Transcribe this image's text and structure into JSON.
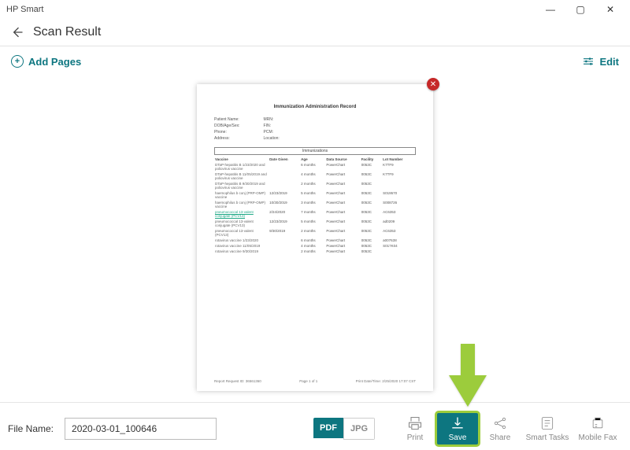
{
  "app_title": "HP Smart",
  "header": {
    "title": "Scan Result"
  },
  "toolbar": {
    "add_pages": "Add Pages",
    "edit": "Edit"
  },
  "preview": {
    "doc_title": "Immunization Administration Record",
    "left_fields": [
      "Patient Name:",
      "DOB/Age/Sex:",
      "Phone:",
      "Address:"
    ],
    "right_labels": [
      "MRN:",
      "FIN:",
      "PCM:",
      "Location:"
    ],
    "section_header": "Immunizations",
    "table": {
      "headers": [
        "Vaccine",
        "Date Given",
        "Age",
        "Data Source",
        "Facility",
        "Lot Number"
      ],
      "rows": [
        {
          "v": "DTaP-hepatitis B 1/23/2020\nand poliovirus\nvaccine",
          "d": "",
          "a": "6 months",
          "s": "PowerChart",
          "f": "0053C",
          "l": "K7TF9"
        },
        {
          "v": "DTaP-hepatitis B 11/05/2019\nand poliovirus\nvaccine",
          "d": "",
          "a": "4 months",
          "s": "PowerChart",
          "f": "0053C",
          "l": "K7TF9"
        },
        {
          "v": "DTaP-hepatitis B 9/30/2019\nand poliovirus\nvaccine",
          "d": "",
          "a": "2 months",
          "s": "PowerChart",
          "f": "0053C",
          "l": ""
        },
        {
          "v": "haemophilus b\nconj (PRP-OMP)\nvaccine",
          "d": "12/23/2019",
          "a": "5 months",
          "s": "PowerChart",
          "f": "0053C",
          "l": "S019570"
        },
        {
          "v": "haemophilus b\nconj (PRP-OMP)\nvaccine",
          "d": "10/30/2019",
          "a": "3 months",
          "s": "PowerChart",
          "f": "0053C",
          "l": "S008726"
        },
        {
          "v": "pneumococcal\n13-valent\nconjugate\n(PCV13)",
          "d": "2/24/2020",
          "a": "7 months",
          "s": "PowerChart",
          "f": "0053C",
          "l": "AC6353",
          "hl": true
        },
        {
          "v": "pneumococcal\n13-valent\nconjugate\n(PCV13)",
          "d": "12/23/2019",
          "a": "5 months",
          "s": "PowerChart",
          "f": "0053C",
          "l": "ad0209"
        },
        {
          "v": "pneumococcal\n13-valent\n(PCV13)",
          "d": "9/30/2019",
          "a": "2 months",
          "s": "PowerChart",
          "f": "0053C",
          "l": "AC6353"
        },
        {
          "v": "rotavirus vaccine 1/23/2020",
          "d": "",
          "a": "6 months",
          "s": "PowerChart",
          "f": "0053C",
          "l": "a007638"
        },
        {
          "v": "rotavirus vaccine 11/05/2019",
          "d": "",
          "a": "4 months",
          "s": "PowerChart",
          "f": "0053C",
          "l": "S017K04"
        },
        {
          "v": "rotavirus vaccine 9/30/2019",
          "d": "",
          "a": "2 months",
          "s": "PowerChart",
          "f": "0053C",
          "l": ""
        }
      ]
    },
    "report_request": "Report Request ID: 36561360",
    "page_indicator": "Page 1 of 1",
    "print_time": "Print Date/Time: 2/25/2020 17:07 CST"
  },
  "file": {
    "label": "File Name:",
    "value": "2020-03-01_100646",
    "fmt_pdf": "PDF",
    "fmt_jpg": "JPG"
  },
  "actions": {
    "print": "Print",
    "save": "Save",
    "share": "Share",
    "smart_tasks": "Smart Tasks",
    "mobile_fax": "Mobile Fax"
  }
}
